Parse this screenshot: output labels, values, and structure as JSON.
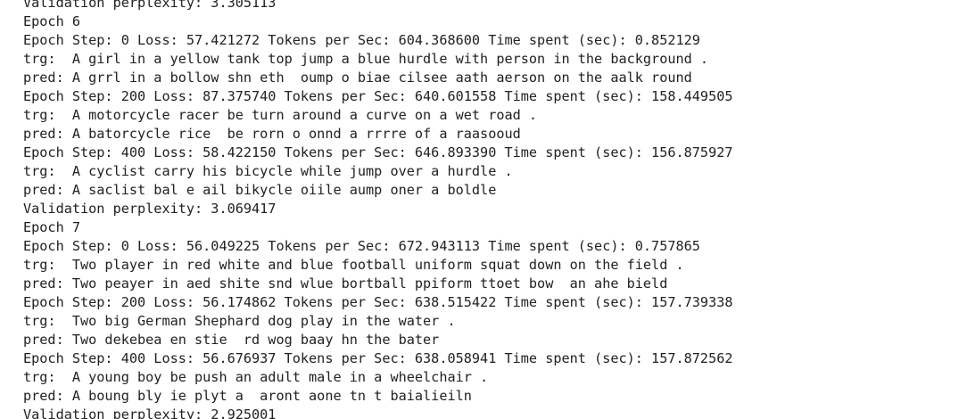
{
  "output": {
    "lines": [
      "Validation perplexity: 3.305113",
      "Epoch 6",
      "Epoch Step: 0 Loss: 57.421272 Tokens per Sec: 604.368600 Time spent (sec): 0.852129",
      "trg:  A girl in a yellow tank top jump a blue hurdle with person in the background .",
      "pred: A grrl in a bollow shn eth  oump o biae cilsee aath aerson on the aalk round",
      "Epoch Step: 200 Loss: 87.375740 Tokens per Sec: 640.601558 Time spent (sec): 158.449505",
      "trg:  A motorcycle racer be turn around a curve on a wet road .",
      "pred: A batorcycle rice  be rorn o onnd a rrrre of a raasooud",
      "Epoch Step: 400 Loss: 58.422150 Tokens per Sec: 646.893390 Time spent (sec): 156.875927",
      "trg:  A cyclist carry his bicycle while jump over a hurdle .",
      "pred: A saclist bal e ail bikycle oiile aump oner a boldle",
      "Validation perplexity: 3.069417",
      "Epoch 7",
      "Epoch Step: 0 Loss: 56.049225 Tokens per Sec: 672.943113 Time spent (sec): 0.757865",
      "trg:  Two player in red white and blue football uniform squat down on the field .",
      "pred: Two peayer in aed shite snd wlue bortball ppiform ttoet bow  an ahe bield",
      "Epoch Step: 200 Loss: 56.174862 Tokens per Sec: 638.515422 Time spent (sec): 157.739338",
      "trg:  Two big German Shephard dog play in the water .",
      "pred: Two dekebea en stie  rd wog baay hn the bater",
      "Epoch Step: 400 Loss: 56.676937 Tokens per Sec: 638.058941 Time spent (sec): 157.872562",
      "trg:  A young boy be push an adult male in a wheelchair .",
      "pred: A boung bly ie plyt a  aront aone tn t baialieiln",
      "Validation perplexity: 2.925001"
    ]
  }
}
